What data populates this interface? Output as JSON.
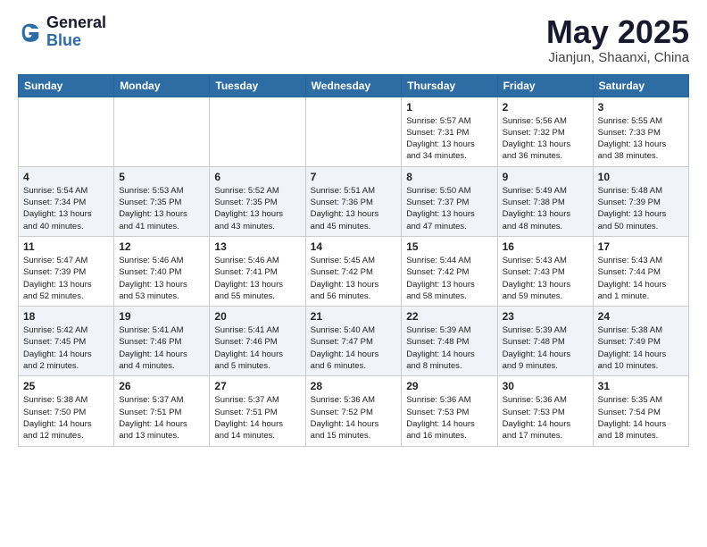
{
  "logo": {
    "general": "General",
    "blue": "Blue"
  },
  "title": "May 2025",
  "subtitle": "Jianjun, Shaanxi, China",
  "weekdays": [
    "Sunday",
    "Monday",
    "Tuesday",
    "Wednesday",
    "Thursday",
    "Friday",
    "Saturday"
  ],
  "weeks": [
    [
      {
        "day": "",
        "info": ""
      },
      {
        "day": "",
        "info": ""
      },
      {
        "day": "",
        "info": ""
      },
      {
        "day": "",
        "info": ""
      },
      {
        "day": "1",
        "info": "Sunrise: 5:57 AM\nSunset: 7:31 PM\nDaylight: 13 hours\nand 34 minutes."
      },
      {
        "day": "2",
        "info": "Sunrise: 5:56 AM\nSunset: 7:32 PM\nDaylight: 13 hours\nand 36 minutes."
      },
      {
        "day": "3",
        "info": "Sunrise: 5:55 AM\nSunset: 7:33 PM\nDaylight: 13 hours\nand 38 minutes."
      }
    ],
    [
      {
        "day": "4",
        "info": "Sunrise: 5:54 AM\nSunset: 7:34 PM\nDaylight: 13 hours\nand 40 minutes."
      },
      {
        "day": "5",
        "info": "Sunrise: 5:53 AM\nSunset: 7:35 PM\nDaylight: 13 hours\nand 41 minutes."
      },
      {
        "day": "6",
        "info": "Sunrise: 5:52 AM\nSunset: 7:35 PM\nDaylight: 13 hours\nand 43 minutes."
      },
      {
        "day": "7",
        "info": "Sunrise: 5:51 AM\nSunset: 7:36 PM\nDaylight: 13 hours\nand 45 minutes."
      },
      {
        "day": "8",
        "info": "Sunrise: 5:50 AM\nSunset: 7:37 PM\nDaylight: 13 hours\nand 47 minutes."
      },
      {
        "day": "9",
        "info": "Sunrise: 5:49 AM\nSunset: 7:38 PM\nDaylight: 13 hours\nand 48 minutes."
      },
      {
        "day": "10",
        "info": "Sunrise: 5:48 AM\nSunset: 7:39 PM\nDaylight: 13 hours\nand 50 minutes."
      }
    ],
    [
      {
        "day": "11",
        "info": "Sunrise: 5:47 AM\nSunset: 7:39 PM\nDaylight: 13 hours\nand 52 minutes."
      },
      {
        "day": "12",
        "info": "Sunrise: 5:46 AM\nSunset: 7:40 PM\nDaylight: 13 hours\nand 53 minutes."
      },
      {
        "day": "13",
        "info": "Sunrise: 5:46 AM\nSunset: 7:41 PM\nDaylight: 13 hours\nand 55 minutes."
      },
      {
        "day": "14",
        "info": "Sunrise: 5:45 AM\nSunset: 7:42 PM\nDaylight: 13 hours\nand 56 minutes."
      },
      {
        "day": "15",
        "info": "Sunrise: 5:44 AM\nSunset: 7:42 PM\nDaylight: 13 hours\nand 58 minutes."
      },
      {
        "day": "16",
        "info": "Sunrise: 5:43 AM\nSunset: 7:43 PM\nDaylight: 13 hours\nand 59 minutes."
      },
      {
        "day": "17",
        "info": "Sunrise: 5:43 AM\nSunset: 7:44 PM\nDaylight: 14 hours\nand 1 minute."
      }
    ],
    [
      {
        "day": "18",
        "info": "Sunrise: 5:42 AM\nSunset: 7:45 PM\nDaylight: 14 hours\nand 2 minutes."
      },
      {
        "day": "19",
        "info": "Sunrise: 5:41 AM\nSunset: 7:46 PM\nDaylight: 14 hours\nand 4 minutes."
      },
      {
        "day": "20",
        "info": "Sunrise: 5:41 AM\nSunset: 7:46 PM\nDaylight: 14 hours\nand 5 minutes."
      },
      {
        "day": "21",
        "info": "Sunrise: 5:40 AM\nSunset: 7:47 PM\nDaylight: 14 hours\nand 6 minutes."
      },
      {
        "day": "22",
        "info": "Sunrise: 5:39 AM\nSunset: 7:48 PM\nDaylight: 14 hours\nand 8 minutes."
      },
      {
        "day": "23",
        "info": "Sunrise: 5:39 AM\nSunset: 7:48 PM\nDaylight: 14 hours\nand 9 minutes."
      },
      {
        "day": "24",
        "info": "Sunrise: 5:38 AM\nSunset: 7:49 PM\nDaylight: 14 hours\nand 10 minutes."
      }
    ],
    [
      {
        "day": "25",
        "info": "Sunrise: 5:38 AM\nSunset: 7:50 PM\nDaylight: 14 hours\nand 12 minutes."
      },
      {
        "day": "26",
        "info": "Sunrise: 5:37 AM\nSunset: 7:51 PM\nDaylight: 14 hours\nand 13 minutes."
      },
      {
        "day": "27",
        "info": "Sunrise: 5:37 AM\nSunset: 7:51 PM\nDaylight: 14 hours\nand 14 minutes."
      },
      {
        "day": "28",
        "info": "Sunrise: 5:36 AM\nSunset: 7:52 PM\nDaylight: 14 hours\nand 15 minutes."
      },
      {
        "day": "29",
        "info": "Sunrise: 5:36 AM\nSunset: 7:53 PM\nDaylight: 14 hours\nand 16 minutes."
      },
      {
        "day": "30",
        "info": "Sunrise: 5:36 AM\nSunset: 7:53 PM\nDaylight: 14 hours\nand 17 minutes."
      },
      {
        "day": "31",
        "info": "Sunrise: 5:35 AM\nSunset: 7:54 PM\nDaylight: 14 hours\nand 18 minutes."
      }
    ]
  ]
}
